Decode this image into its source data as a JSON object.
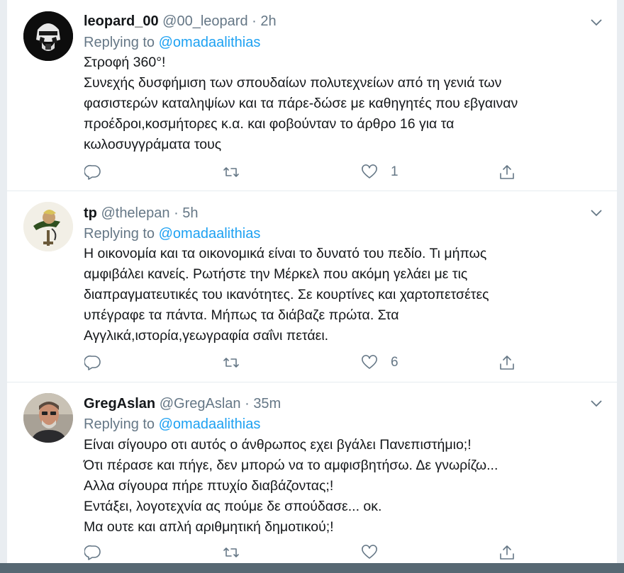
{
  "tweets": [
    {
      "name": "leopard_00",
      "handle": "@00_leopard",
      "separator": "·",
      "time": "2h",
      "replying_prefix": "Replying to",
      "replying_to": "@omadaalithias",
      "lines": [
        "Στροφή 360°!",
        "Συνεχής δυσφήμιση των σπουδαίων πολυτεχνείων από τη γενιά των",
        "φασιστερών καταληψίων και τα πάρε-δώσε με καθηγητές που εβγαιναν",
        "προέδροι,κοσμήτορες κ.α. και φοβούνταν το άρθρο 16 για τα",
        "κωλοσυγγράματα τους"
      ],
      "reply_count": "",
      "retweet_count": "",
      "like_count": "1"
    },
    {
      "name": "tp",
      "handle": "@thelepan",
      "separator": "·",
      "time": "5h",
      "replying_prefix": "Replying to",
      "replying_to": "@omadaalithias",
      "lines": [
        "Η οικονομία και τα οικονομικά είναι το δυνατό του πεδίο. Τι μήπως",
        "αμφιβάλει κανείς. Ρωτήστε την Μέρκελ που ακόμη γελάει με τις",
        "διαπραγματευτικές του ικανότητες. Σε κουρτίνες και χαρτοπετσέτες",
        "υπέγραφε τα πάντα. Μήπως τα διάβαζε πρώτα. Στα",
        "Αγγλικά,ιστορία,γεωγραφία σαΐνι πετάει."
      ],
      "reply_count": "",
      "retweet_count": "",
      "like_count": "6"
    },
    {
      "name": "GregAslan",
      "handle": "@GregAslan",
      "separator": "·",
      "time": "35m",
      "replying_prefix": "Replying to",
      "replying_to": "@omadaalithias",
      "lines": [
        "Είναι σίγουρο οτι αυτός ο άνθρωπος εχει βγάλει Πανεπιστήμιο;!",
        "Ότι πέρασε και πήγε, δεν μπορώ να το αμφισβητήσω. Δε γνωρίζω...",
        "Αλλα σίγουρα πήρε πτυχίο διαβάζοντας;!",
        "Εντάξει, λογοτεχνία ας πούμε δε σπούδασε... οκ.",
        "Μα ουτε και απλή αριθμητική δημοτικού;!"
      ],
      "reply_count": "",
      "retweet_count": "",
      "like_count": ""
    }
  ],
  "icons": {
    "reply": "reply-icon",
    "retweet": "retweet-icon",
    "like": "heart-icon",
    "share": "share-icon",
    "caret": "chevron-down-icon"
  },
  "colors": {
    "link": "#1da1f2",
    "muted": "#657786",
    "text": "#14171a"
  }
}
